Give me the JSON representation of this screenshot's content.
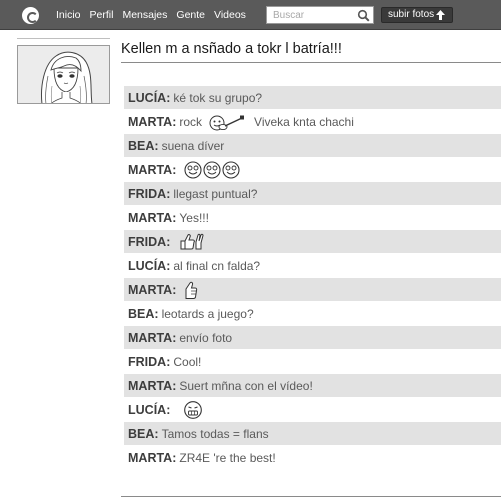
{
  "nav": {
    "items": [
      "Inicio",
      "Perfil",
      "Mensajes",
      "Gente",
      "Videos"
    ],
    "search_placeholder": "Buscar",
    "upload_label": "subir fotos"
  },
  "post": {
    "title": "Kellen m a nsñado a tokr l batría!!!"
  },
  "chat": [
    {
      "speaker": "LUCÍA:",
      "text": "ké tok su grupo?"
    },
    {
      "speaker": "MARTA:",
      "text": "rock",
      "after_icon_text": "Viveka knta chachi",
      "icon": "guitar-icon"
    },
    {
      "speaker": "BEA:",
      "text": "suena díver"
    },
    {
      "speaker": "MARTA:",
      "text": "",
      "icon": "three-smileys-icon"
    },
    {
      "speaker": "FRIDA:",
      "text": "llegast puntual?"
    },
    {
      "speaker": "MARTA:",
      "text": "Yes!!!"
    },
    {
      "speaker": "FRIDA:",
      "text": "",
      "icon": "thumbs-up-peace-icon"
    },
    {
      "speaker": "LUCÍA:",
      "text": "al final cn falda?"
    },
    {
      "speaker": "MARTA:",
      "text": "",
      "icon": "thumbs-up-icon"
    },
    {
      "speaker": "BEA:",
      "text": "leotards a juego?"
    },
    {
      "speaker": "MARTA:",
      "text": "envío foto"
    },
    {
      "speaker": "FRIDA:",
      "text": "Cool!"
    },
    {
      "speaker": "MARTA:",
      "text": "Suert mñna con el vídeo!"
    },
    {
      "speaker": "LUCÍA:",
      "text": "",
      "icon": "nervous-face-icon"
    },
    {
      "speaker": "BEA:",
      "text": "Tamos todas = flans"
    },
    {
      "speaker": "MARTA:",
      "text": "ZR4E 're the best!"
    }
  ]
}
